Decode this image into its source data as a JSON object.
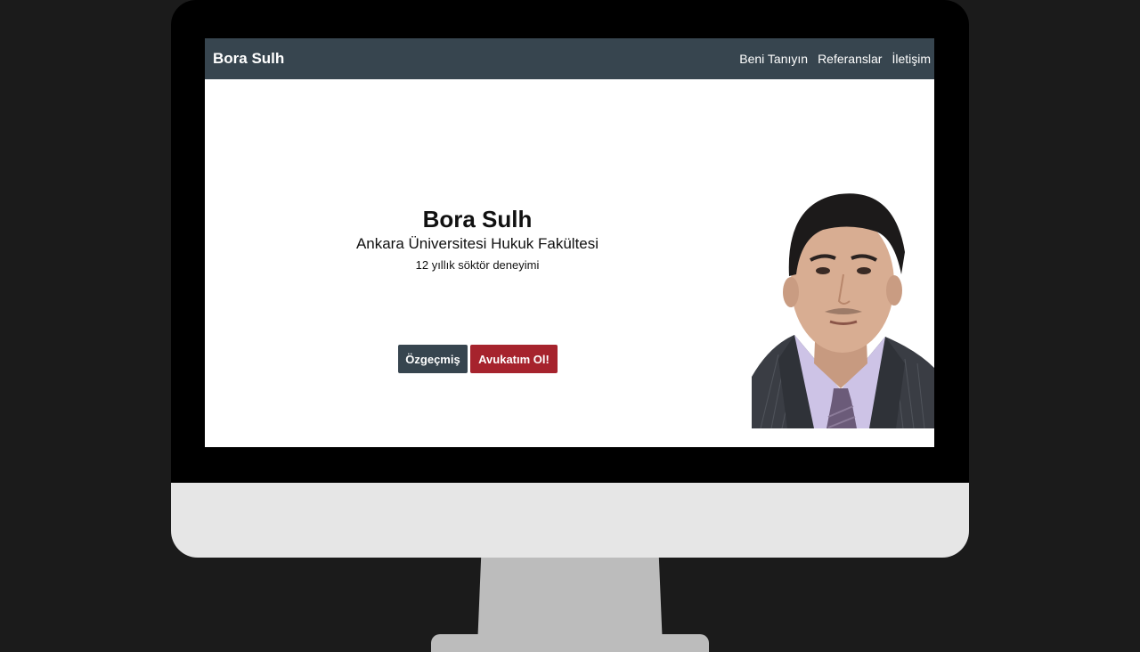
{
  "navbar": {
    "brand": "Bora Sulh",
    "links": [
      {
        "label": "Beni Tanıyın"
      },
      {
        "label": "Referanslar"
      },
      {
        "label": "İletişim"
      }
    ]
  },
  "hero": {
    "name": "Bora Sulh",
    "school": "Ankara Üniversitesi Hukuk Fakültesi",
    "experience": "12 yıllık söktör deneyimi"
  },
  "buttons": {
    "cv": "Özgeçmiş",
    "hire": "Avukatım Ol!"
  },
  "colors": {
    "navbar": "#37454f",
    "accent_red": "#a6232d",
    "background": "#1b1b1b"
  },
  "icons": {
    "portrait": "lawyer-portrait-photo"
  }
}
